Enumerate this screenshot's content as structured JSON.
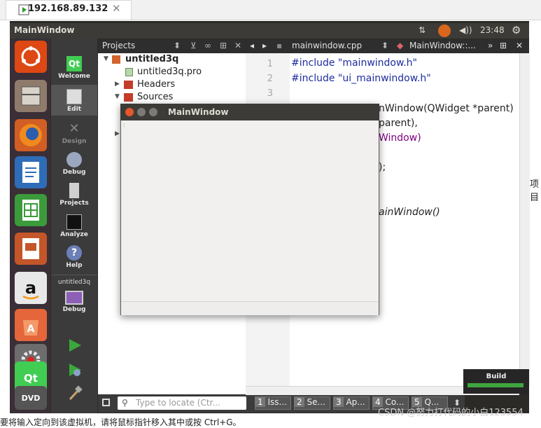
{
  "browser": {
    "tab_title": "192.168.89.132",
    "tab_close": "✕"
  },
  "ubuntu": {
    "window_title": "MainWindow",
    "clock": "23:48",
    "launcher_icons": [
      "ubuntu-dash-icon",
      "file-manager-icon",
      "firefox-icon",
      "writer-icon",
      "calc-icon",
      "impress-icon",
      "amazon-icon",
      "software-center-icon",
      "system-settings-icon",
      "qt-creator-icon",
      "dvd-icon"
    ]
  },
  "modes": [
    {
      "label": "Welcome"
    },
    {
      "label": "Edit"
    },
    {
      "label": "Design"
    },
    {
      "label": "Debug"
    },
    {
      "label": "Projects"
    },
    {
      "label": "Analyze"
    },
    {
      "label": "Help"
    }
  ],
  "kit": {
    "project": "untitled3q",
    "config": "Debug"
  },
  "projects_panel": {
    "title": "Projects",
    "tree": [
      {
        "label": "untitled3q",
        "bold": true
      },
      {
        "label": "untitled3q.pro"
      },
      {
        "label": "Headers"
      },
      {
        "label": "Sources"
      }
    ]
  },
  "editor": {
    "file": "mainwindow.cpp",
    "symbol": "MainWindow::...",
    "line_numbers": [
      "1",
      "2",
      "3"
    ],
    "lines": [
      {
        "text": "#include \"mainwindow.h\""
      },
      {
        "text": "#include \"ui_mainwindow.h\""
      },
      {
        "text": "nWindow(QWidget *parent)"
      },
      {
        "text": "parent),"
      },
      {
        "text": "Window)"
      },
      {
        "text": ");"
      },
      {
        "text": "ainWindow()"
      }
    ]
  },
  "bottom_bar": {
    "locator_placeholder": "Type to locate (Ctr...",
    "tabs": [
      {
        "num": "1",
        "label": "Iss..."
      },
      {
        "num": "2",
        "label": "Se..."
      },
      {
        "num": "3",
        "label": "Ap..."
      },
      {
        "num": "4",
        "label": "Co..."
      },
      {
        "num": "5",
        "label": "Q..."
      }
    ]
  },
  "build": {
    "label": "Build"
  },
  "floating_window": {
    "title": "MainWindow"
  },
  "watermark": "CSDN @努力打代码的小白123554",
  "page_bottom_text": "要将输入定向到该虚拟机，请将鼠标指针移入其中或按 Ctrl+G。",
  "edge_text": "项目",
  "colors": {
    "keyword": "#1e2d9e",
    "string": "#008000",
    "type": "#800080",
    "accent": "#e95420"
  }
}
